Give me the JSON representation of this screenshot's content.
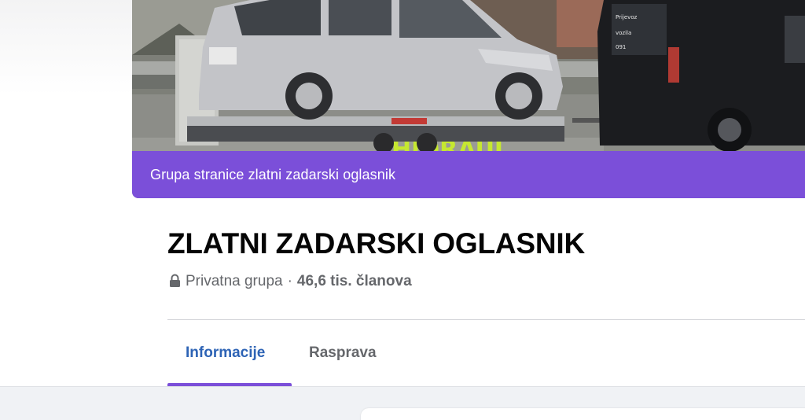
{
  "cover": {
    "image_description": "group-cover-photo-car-on-tow-trailer",
    "banner_prefix": "Grupa stranice ",
    "banner_link": "zlatni zadarski oglasnik",
    "banner_color": "#7b4fd9"
  },
  "group": {
    "title": "ZLATNI ZADARSKI OGLASNIK",
    "privacy": "Privatna grupa",
    "separator": "·",
    "members": "46,6 tis. članova"
  },
  "tabs": [
    {
      "label": "Informacije",
      "active": true
    },
    {
      "label": "Rasprava",
      "active": false
    }
  ],
  "colors": {
    "accent": "#7b4fd9",
    "active_tab_text": "#2d63b5",
    "secondary_text": "#65676b"
  }
}
